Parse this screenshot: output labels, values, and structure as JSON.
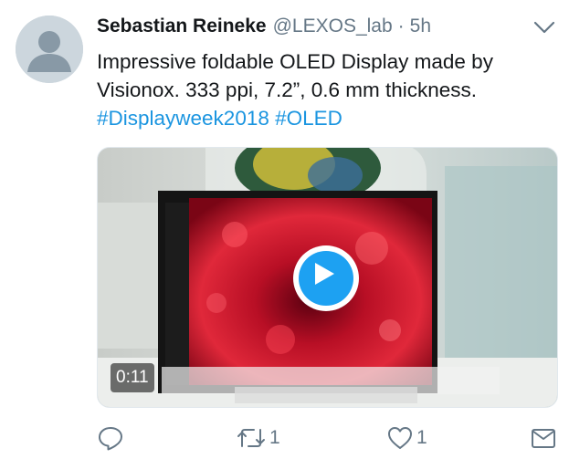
{
  "tweet": {
    "author_name": "Sebastian Reineke",
    "handle": "@LEXOS_lab",
    "separator": "·",
    "time": "5h",
    "text_lines": [
      "Impressive foldable OLED Display made by",
      "Visionox. 333 ppi, 7.2”, 0.6 mm thickness."
    ],
    "hashtags": [
      "#Displayweek2018",
      "#OLED"
    ]
  },
  "media": {
    "type": "video",
    "duration": "0:11",
    "brand_text": "Visionox"
  },
  "actions": {
    "reply_icon": "reply-icon",
    "retweet_icon": "retweet-icon",
    "retweet_count": "1",
    "like_icon": "heart-icon",
    "like_count": "1",
    "dm_icon": "envelope-icon"
  },
  "colors": {
    "link": "#1b95e0",
    "secondary_text": "#657786",
    "play_button": "#1da1f2"
  }
}
